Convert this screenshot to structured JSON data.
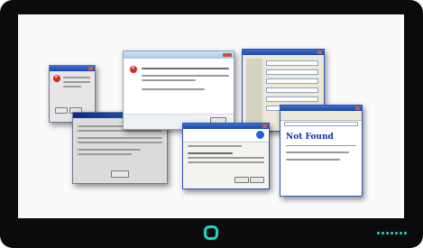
{
  "device": {
    "accent": "#20d6c6",
    "bezel": "#0b0b0d"
  },
  "windows": [
    {
      "id": "small-error-dialog",
      "title": ""
    },
    {
      "id": "vista-error-dialog",
      "title": ""
    },
    {
      "id": "xp-form-window",
      "title": ""
    },
    {
      "id": "classic-dialog",
      "title": ""
    },
    {
      "id": "xp-info-dialog",
      "title": ""
    },
    {
      "id": "browser-window",
      "title": "",
      "heading": "Not Found"
    }
  ]
}
